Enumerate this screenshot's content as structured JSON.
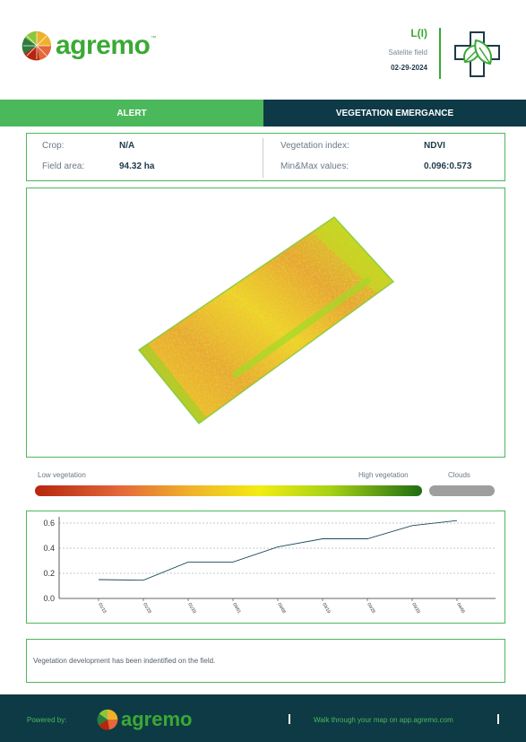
{
  "header": {
    "brand": "agremo",
    "field_name": "L(I)",
    "field_type": "Satelite field",
    "date": "02-29-2024",
    "icon": "leaf-cross-icon"
  },
  "tabs": {
    "alert": "ALERT",
    "vegetation": "VEGETATION EMERGANCE"
  },
  "info": {
    "crop_label": "Crop:",
    "crop_value": "N/A",
    "area_label": "Field area:",
    "area_value": "94.32 ha",
    "index_label": "Vegetation index:",
    "index_value": "NDVI",
    "minmax_label": "Min&Max values:",
    "minmax_value": "0.096:0.573"
  },
  "legend": {
    "low": "Low vegetation",
    "high": "High vegetation",
    "clouds": "Clouds",
    "colors": [
      "#b5260f",
      "#e3683a",
      "#f0b12a",
      "#f2ec12",
      "#a7d215",
      "#1f6d13"
    ],
    "cloud_color": "#9e9e9e"
  },
  "chart_data": {
    "type": "line",
    "title": "",
    "xlabel": "",
    "ylabel": "",
    "x": [
      "01/15",
      "01/28",
      "01/29",
      "03/01",
      "03/08",
      "03/19",
      "03/26",
      "03/29",
      "04/05"
    ],
    "series": [
      {
        "values": [
          0.15,
          0.145,
          0.29,
          0.29,
          0.41,
          0.475,
          0.475,
          0.58,
          0.62
        ]
      }
    ],
    "ylim": [
      0,
      0.65
    ],
    "yticks": [
      "0.0",
      "0.2",
      "0.4",
      "0.6"
    ],
    "grid": true,
    "line_color": "#1e4a5a"
  },
  "note": {
    "text": "Vegetation development has been indentified on the field."
  },
  "footer": {
    "powered_by": "Powered by:",
    "brand": "agremo",
    "walk_text": "Walk through your map on  app.agremo.com"
  }
}
